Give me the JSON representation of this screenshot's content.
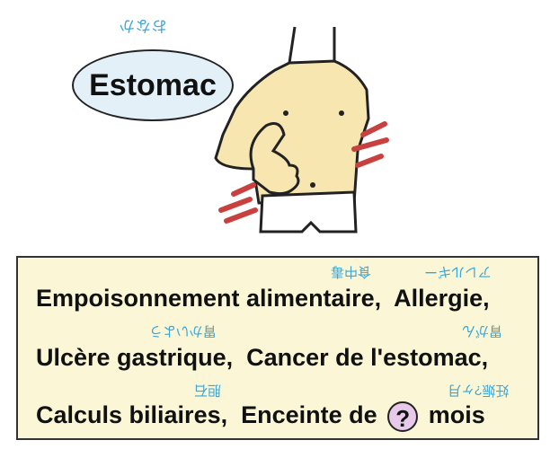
{
  "title": {
    "ruby": "おなか",
    "label": "Estomac"
  },
  "lines": [
    {
      "items": [
        {
          "text": "Empoisonnement alimentaire,",
          "ruby": "食中毒"
        },
        {
          "text": "Allergie,",
          "ruby": "アレルギー"
        }
      ]
    },
    {
      "items": [
        {
          "text": "Ulcère gastrique,",
          "ruby": "胃かいよう"
        },
        {
          "text": "Cancer de l'estomac,",
          "ruby": "胃がん"
        }
      ]
    },
    {
      "items": [
        {
          "text": "Calculs biliaires,",
          "ruby": "胆石"
        },
        {
          "text_before": "Enceinte de",
          "q": "?",
          "text_after": "mois",
          "ruby": "妊娠?ヶ月"
        }
      ]
    }
  ]
}
